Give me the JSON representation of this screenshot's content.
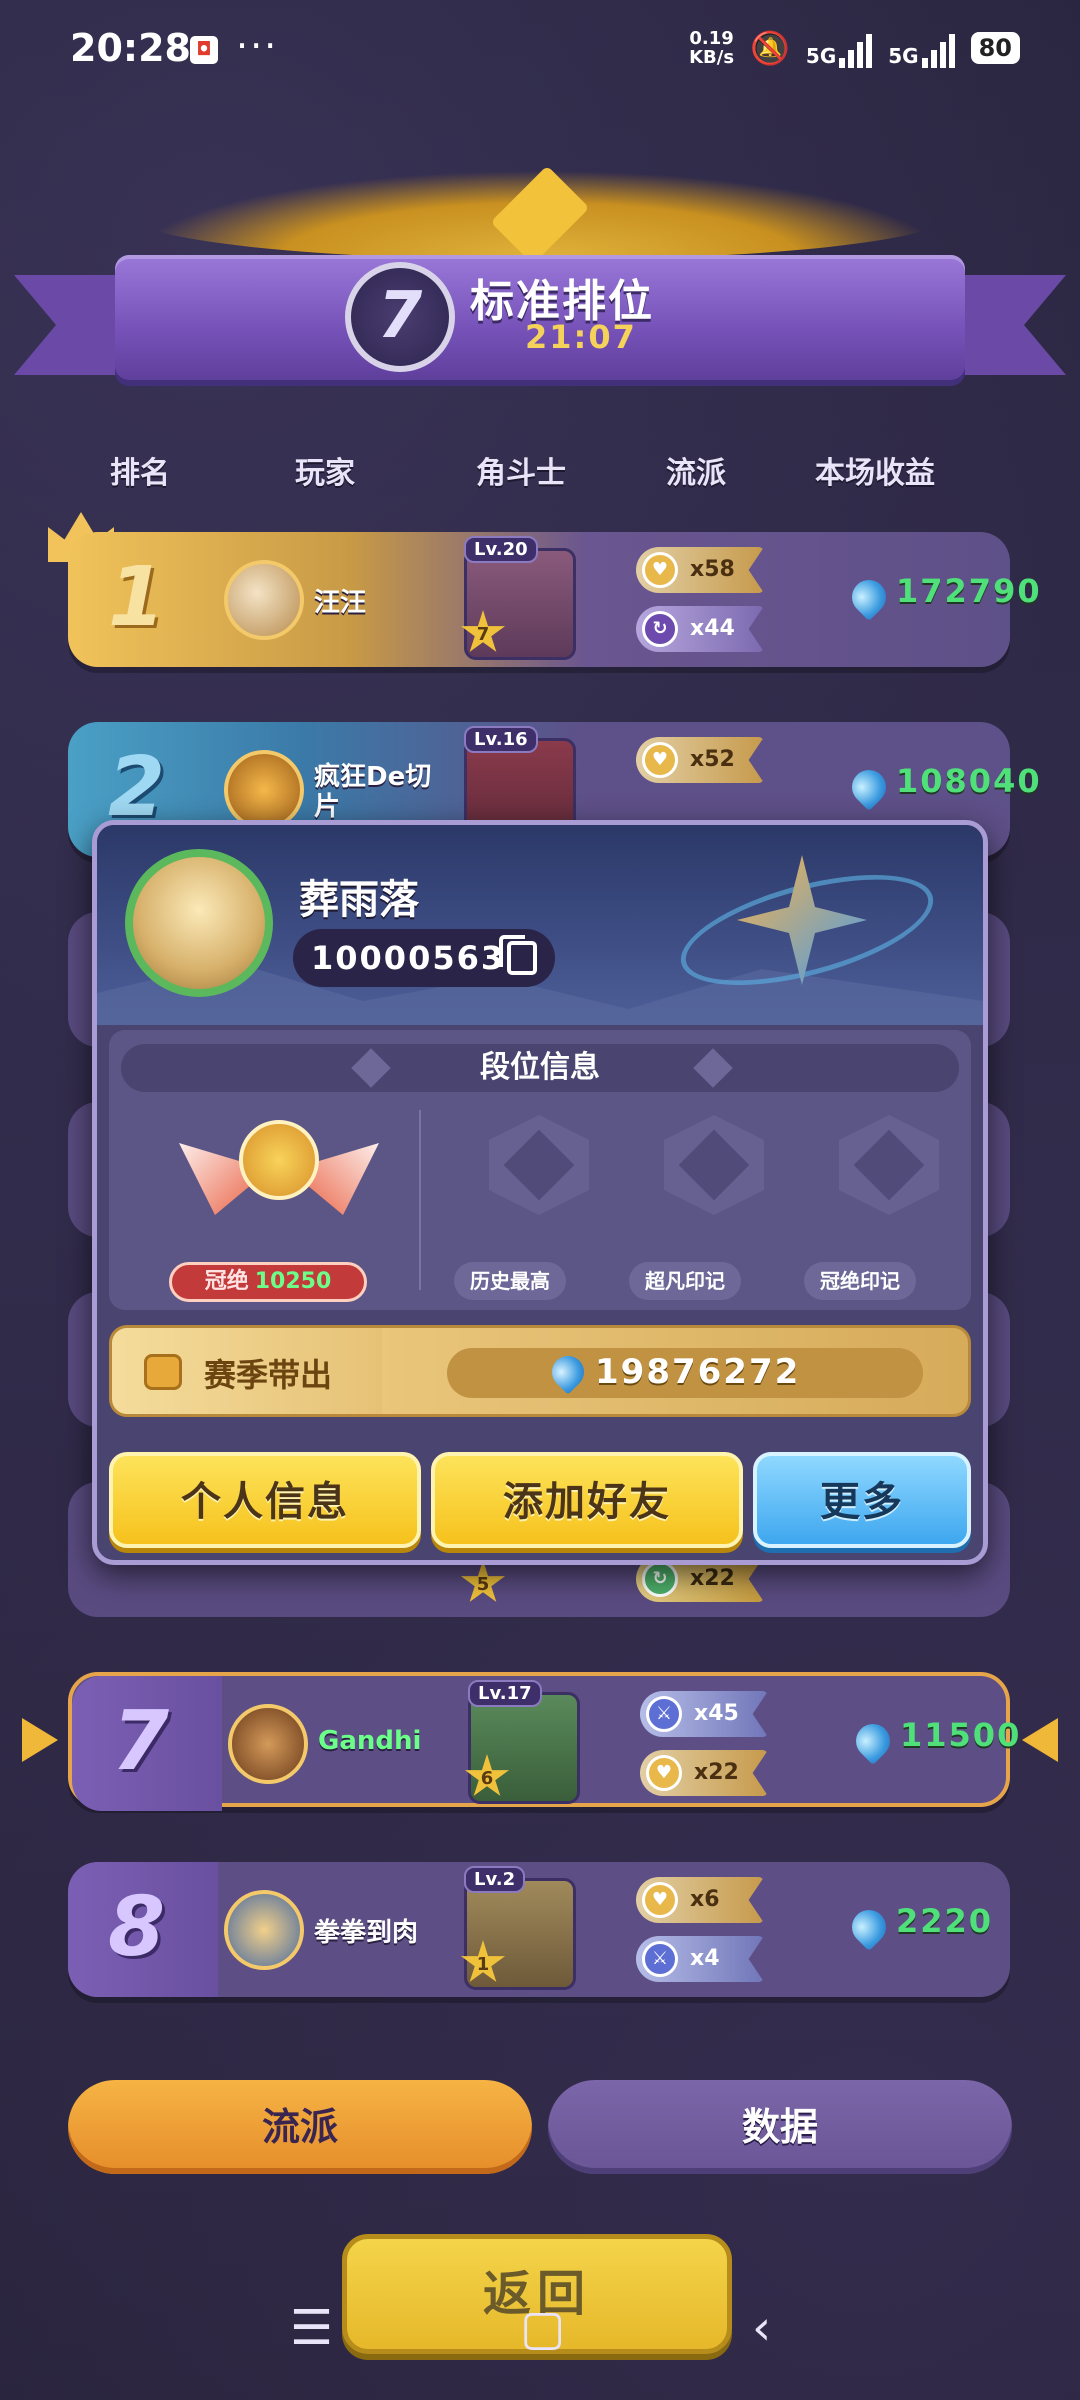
{
  "status_bar": {
    "time": "20:28",
    "net_speed_value": "0.19",
    "net_speed_unit": "KB/s",
    "sig1_label": "5G",
    "sig2_label": "5G",
    "battery": "80"
  },
  "header": {
    "badge_number": "7",
    "title": "标准排位",
    "timer": "21:07"
  },
  "columns": {
    "rank": "排名",
    "player": "玩家",
    "gladiator": "角斗士",
    "style": "流派",
    "income": "本场收益"
  },
  "rows": {
    "r1": {
      "rank": "1",
      "name": "汪汪",
      "level": "Lv.20",
      "star": "7",
      "tag1": "x58",
      "tag2": "x44",
      "income": "172790"
    },
    "r2": {
      "rank": "2",
      "name": "疯狂De切片",
      "level": "Lv.16",
      "income": "108040"
    },
    "r7": {
      "rank": "7",
      "name": "Gandhi",
      "level": "Lv.17",
      "star": "6",
      "tag1": "x45",
      "tag2": "x22",
      "income": "11500"
    },
    "r8": {
      "rank": "8",
      "name": "拳拳到肉",
      "level": "Lv.2",
      "star": "1",
      "tag1": "x6",
      "tag2": "x4",
      "income": "2220"
    },
    "r6_partial": {
      "star": "5",
      "tag2": "x22"
    }
  },
  "popup": {
    "player_name": "葬雨落",
    "player_id": "10000563",
    "section_title": "段位信息",
    "current_rank_label": "冠绝",
    "current_rank_score": "10250",
    "slot_history": "历史最高",
    "slot_extra_mark": "超凡印记",
    "slot_peak_mark": "冠绝印记",
    "season_label": "赛季带出",
    "season_value": "19876272",
    "btn_profile": "个人信息",
    "btn_add_friend": "添加好友",
    "btn_more": "更多"
  },
  "bottom": {
    "tab_style": "流派",
    "tab_data": "数据",
    "back": "返回"
  },
  "colors": {
    "income_green": "#4fe07a",
    "gold": "#f1c35a",
    "purple_bg": "#2e2a45",
    "button_yellow": "#f6c21d",
    "button_blue": "#3ea7ef"
  },
  "icons": [
    "gold-coin-icon",
    "purple-swirl-icon",
    "blue-sword-icon",
    "green-swirl-icon",
    "gem-icon",
    "copy-icon",
    "crown-icon",
    "star-icon"
  ]
}
